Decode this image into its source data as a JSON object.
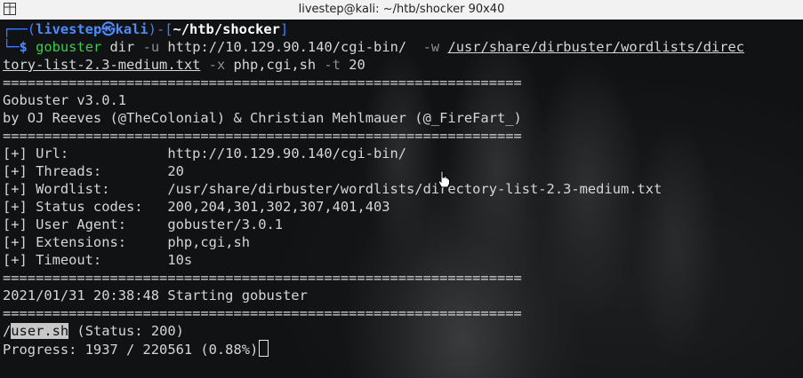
{
  "window": {
    "title": "livestep@kali: ~/htb/shocker 90x40",
    "icon": "terminal-window-icon"
  },
  "prompt": {
    "open": "┌──(",
    "user_host": "livestep㉿kali",
    "mid": ")-[",
    "path": "~/htb/shocker",
    "close": "]",
    "second_prefix": "└─",
    "dollar": "$"
  },
  "command": {
    "program": "gobuster",
    "subcommand": " dir ",
    "flag_u": "-u",
    "url": " http://10.129.90.140/cgi-bin/  ",
    "flag_w": "-w",
    "space": " ",
    "wordlist_part1": "/usr/share/dirbuster/wordlists/direc",
    "wordlist_part2": "tory-list-2.3-medium.txt",
    "flag_x": "-x",
    "ext": " php,cgi,sh ",
    "flag_t": "-t",
    "threads": " 20"
  },
  "separator": "===============================================================",
  "banner": {
    "version": "Gobuster v3.0.1",
    "authors": "by OJ Reeves (@TheColonial) & Christian Mehlmauer (@_FireFart_)"
  },
  "settings": [
    {
      "key": "[+] Url:            ",
      "value": "http://10.129.90.140/cgi-bin/"
    },
    {
      "key": "[+] Threads:        ",
      "value": "20"
    },
    {
      "key": "[+] Wordlist:       ",
      "value": "/usr/share/dirbuster/wordlists/directory-list-2.3-medium.txt"
    },
    {
      "key": "[+] Status codes:   ",
      "value": "200,204,301,302,307,401,403"
    },
    {
      "key": "[+] User Agent:     ",
      "value": "gobuster/3.0.1"
    },
    {
      "key": "[+] Extensions:     ",
      "value": "php,cgi,sh"
    },
    {
      "key": "[+] Timeout:        ",
      "value": "10s"
    }
  ],
  "start_line": "2021/01/31 20:38:48 Starting gobuster",
  "result": {
    "slash": "/",
    "name": "user.sh",
    "status": " (Status: 200)"
  },
  "progress": "Progress: 1937 / 220561 (0.88%)",
  "colors": {
    "background": "#111214",
    "prompt_blue": "#3f7fff",
    "command_green": "#2fd14a",
    "text": "#d6d6d6"
  }
}
